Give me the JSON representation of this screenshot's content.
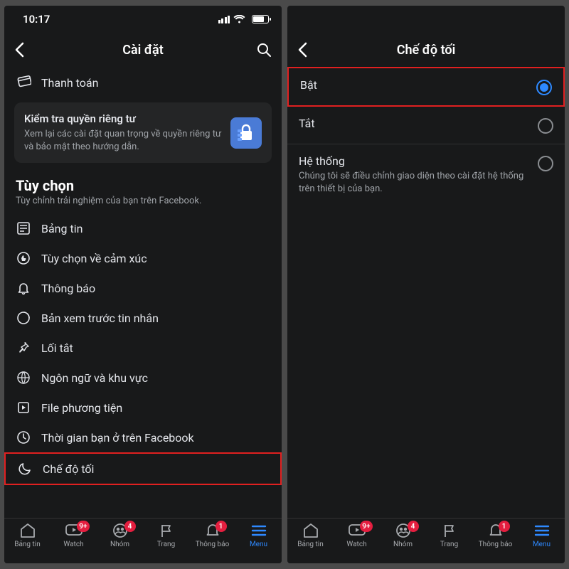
{
  "status": {
    "time": "10:17"
  },
  "left": {
    "title": "Cài đặt",
    "payment": "Thanh toán",
    "privacy_card": {
      "title": "Kiểm tra quyền riêng tư",
      "sub": "Xem lại các cài đặt quan trọng về quyền riêng tư và bảo mật theo hướng dẫn."
    },
    "section": {
      "title": "Tùy chọn",
      "sub": "Tùy chỉnh trải nghiệm của bạn trên Facebook."
    },
    "items": {
      "feed": "Bảng tin",
      "reaction": "Tùy chọn về cảm xúc",
      "notif": "Thông báo",
      "preview": "Bản xem trước tin nhắn",
      "shortcut": "Lối tắt",
      "lang": "Ngôn ngữ và khu vực",
      "media": "File phương tiện",
      "time": "Thời gian bạn ở trên Facebook",
      "dark": "Chế độ tối"
    }
  },
  "right": {
    "title": "Chế độ tối",
    "options": {
      "on": "Bật",
      "off": "Tắt",
      "system": "Hệ thống",
      "system_desc": "Chúng tôi sẽ điều chỉnh giao diện theo cài đặt hệ thống trên thiết bị của bạn."
    }
  },
  "tabs": {
    "feed": "Bảng tin",
    "watch": "Watch",
    "groups": "Nhóm",
    "pages": "Trang",
    "notif": "Thông báo",
    "menu": "Menu",
    "badges": {
      "watch": "9+",
      "groups": "4",
      "notif": "1"
    }
  }
}
